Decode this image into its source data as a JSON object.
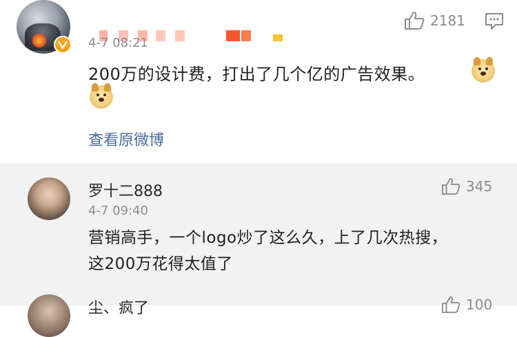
{
  "main_comment": {
    "timestamp": "4-7 08:21",
    "likes": "2181",
    "text_line1": "200万的设计费，打出了几个亿的广告效果。",
    "view_original": "查看原微博"
  },
  "replies": [
    {
      "username": "罗十二888",
      "timestamp": "4-7 09:40",
      "likes": "345",
      "text_line1": "营销高手，一个logo炒了这么久，上了几次热搜，",
      "text_line2": "这200万花得太值了"
    },
    {
      "username": "尘、疯了",
      "likes": "100"
    }
  ],
  "colors": {
    "link": "#4a6d9a",
    "meta": "#8b8b8b",
    "reply_bg": "#f2f2f2",
    "verified_badge": "#f7a21b"
  },
  "icons": {
    "like": "thumbs-up-icon",
    "comment": "comment-icon",
    "emoji": "doge-emoji-icon",
    "verified": "verified-v-icon"
  }
}
